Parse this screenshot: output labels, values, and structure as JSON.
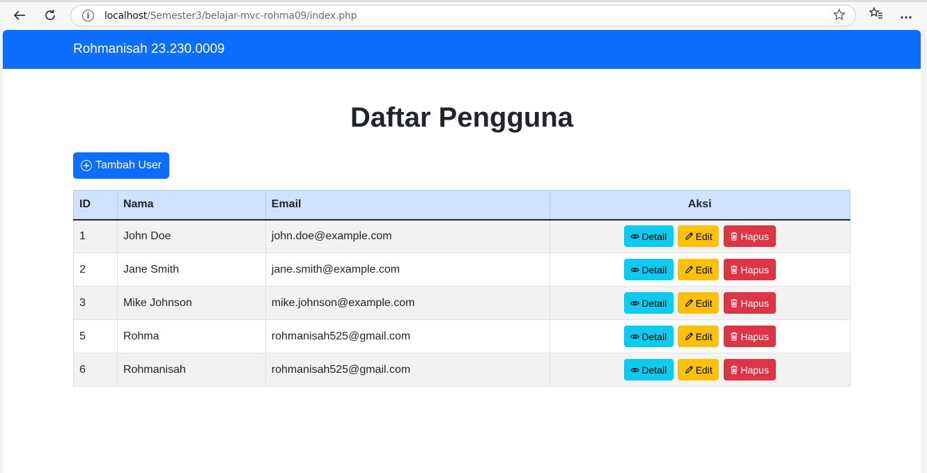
{
  "browser": {
    "url_host": "localhost",
    "url_path": "/Semester3/belajar-mvc-rohma09/index.php"
  },
  "navbar": {
    "brand": "Rohmanisah 23.230.0009"
  },
  "page": {
    "title": "Daftar Pengguna",
    "add_button_label": "Tambah User"
  },
  "table": {
    "headers": {
      "id": "ID",
      "nama": "Nama",
      "email": "Email",
      "aksi": "Aksi"
    },
    "action_labels": {
      "detail": "Detail",
      "edit": "Edit",
      "hapus": "Hapus"
    },
    "rows": [
      {
        "id": "1",
        "nama": "John Doe",
        "email": "john.doe@example.com"
      },
      {
        "id": "2",
        "nama": "Jane Smith",
        "email": "jane.smith@example.com"
      },
      {
        "id": "3",
        "nama": "Mike Johnson",
        "email": "mike.johnson@example.com"
      },
      {
        "id": "5",
        "nama": "Rohma",
        "email": "rohmanisah525@gmail.com"
      },
      {
        "id": "6",
        "nama": "Rohmanisah",
        "email": "rohmanisah525@gmail.com"
      }
    ]
  },
  "colors": {
    "primary": "#0d6efd",
    "info": "#0dcaf0",
    "warning": "#ffc107",
    "danger": "#dc3545",
    "table_head": "#cfe2ff"
  },
  "icons": [
    "back-arrow-icon",
    "reload-icon",
    "info-icon",
    "star-icon",
    "favorites-icon",
    "more-icon",
    "plus-circle-icon",
    "eye-icon",
    "pencil-icon",
    "trash-icon"
  ]
}
